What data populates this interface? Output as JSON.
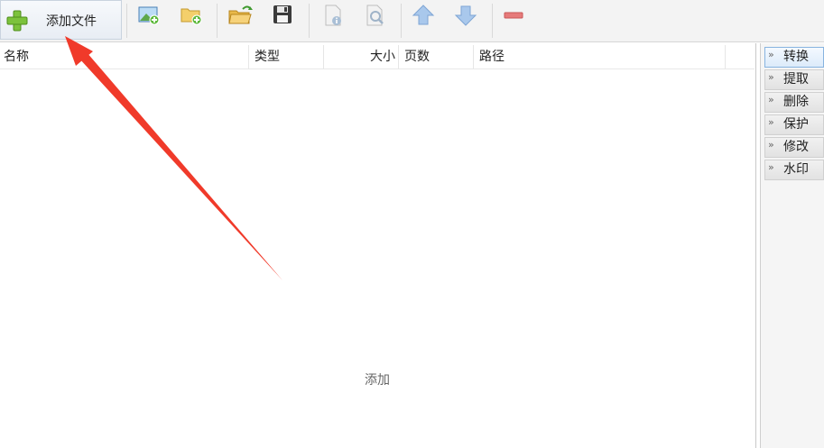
{
  "toolbar": {
    "add_file_label": "添加文件",
    "buttons": [
      {
        "icon": "add-image-icon"
      },
      {
        "icon": "add-folder-icon"
      },
      {
        "icon": "open-folder-icon"
      },
      {
        "icon": "save-icon"
      },
      {
        "icon": "file-info-icon"
      },
      {
        "icon": "preview-search-icon"
      },
      {
        "icon": "move-up-icon"
      },
      {
        "icon": "move-down-icon"
      },
      {
        "icon": "remove-icon"
      }
    ]
  },
  "list": {
    "columns": [
      "名称",
      "类型",
      "大小",
      "页数",
      "路径"
    ],
    "empty_hint": "添加"
  },
  "side": {
    "items": [
      "转换",
      "提取",
      "删除",
      "保护",
      "修改",
      "水印"
    ],
    "active_index": 0
  },
  "colors": {
    "accent_blue": "#88b4e0",
    "plus_green": "#7cc23c",
    "annotation_red": "#f03a2a"
  }
}
